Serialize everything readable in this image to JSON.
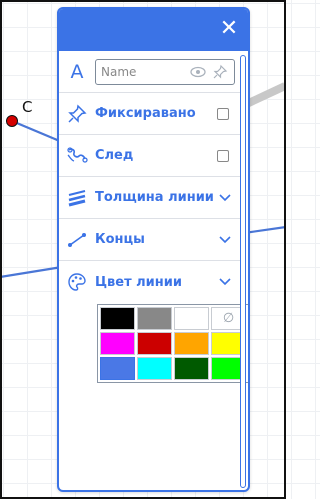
{
  "canvas": {
    "point_label": "C",
    "point_color": "#d40000",
    "line_color": "#4a76d6"
  },
  "panel": {
    "close_icon": "close-icon",
    "accent_color": "#3b73e6",
    "name_field": {
      "placeholder": "Name",
      "value": ""
    },
    "rows": [
      {
        "id": "pinned",
        "label": "Фиксиравано",
        "icon": "pin-icon",
        "control": "checkbox",
        "checked": false
      },
      {
        "id": "trace",
        "label": "След",
        "icon": "trace-icon",
        "control": "checkbox",
        "checked": false
      },
      {
        "id": "line-thickness",
        "label": "Толщина линии",
        "icon": "line-thickness-icon",
        "control": "expand"
      },
      {
        "id": "line-ends",
        "label": "Концы",
        "icon": "line-ends-icon",
        "control": "expand"
      },
      {
        "id": "line-color",
        "label": "Цвет линии",
        "icon": "palette-icon",
        "control": "expand"
      }
    ],
    "colors": [
      {
        "hex": "#000000"
      },
      {
        "hex": "#888888"
      },
      {
        "hex": "#ffffff"
      },
      {
        "hex": "none",
        "symbol": "∅"
      },
      {
        "hex": "#ff00ff"
      },
      {
        "hex": "#cc0000"
      },
      {
        "hex": "#ffa500"
      },
      {
        "hex": "#ffff00"
      },
      {
        "hex": "#4a78e6",
        "selected": true
      },
      {
        "hex": "#00ffff"
      },
      {
        "hex": "#005a00"
      },
      {
        "hex": "#00ff00"
      }
    ]
  }
}
